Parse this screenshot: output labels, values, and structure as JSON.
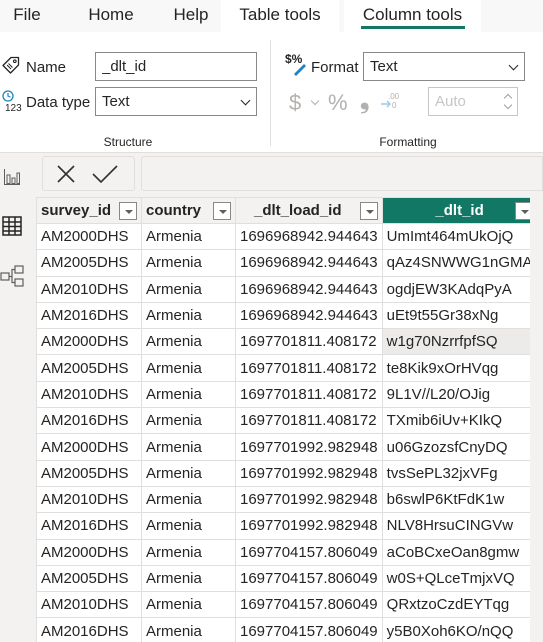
{
  "menu": {
    "tabs": [
      {
        "label": "File",
        "active": false
      },
      {
        "label": "Home",
        "active": false
      },
      {
        "label": "Help",
        "active": false
      },
      {
        "label": "Table tools",
        "active": false
      },
      {
        "label": "Column tools",
        "active": true
      }
    ],
    "accent_color": "#117865"
  },
  "ribbon": {
    "structure": {
      "group_label": "Structure",
      "name_label": "Name",
      "name_value": "_dlt_id",
      "data_type_label": "Data type",
      "data_type_value": "Text",
      "name_icon": "tag-icon",
      "data_type_icon": "data-type-123-icon"
    },
    "formatting": {
      "group_label": "Formatting",
      "format_label": "Format",
      "format_value": "Text",
      "format_icon": "dollar-percent-brush-icon",
      "currency_symbol": "$",
      "percent_symbol": "%",
      "comma_symbol": "❟",
      "decimal_places_placeholder": "Auto",
      "decimal_icon_text": ".00"
    }
  },
  "rail": {
    "items": [
      {
        "name": "report-view",
        "icon": "bar-chart-icon"
      },
      {
        "name": "data-view",
        "icon": "table-icon",
        "active": true
      },
      {
        "name": "model-view",
        "icon": "model-icon"
      }
    ]
  },
  "formula_bar": {
    "cancel_icon": "close-icon",
    "commit_icon": "check-icon",
    "value": ""
  },
  "table": {
    "columns": [
      {
        "key": "survey_id",
        "label": "survey_id",
        "selected": false
      },
      {
        "key": "country",
        "label": "country",
        "selected": false
      },
      {
        "key": "_dlt_load_id",
        "label": "_dlt_load_id",
        "selected": false
      },
      {
        "key": "_dlt_id",
        "label": "_dlt_id",
        "selected": true
      }
    ],
    "rows": [
      [
        "AM2000DHS",
        "Armenia",
        "1696968942.944643",
        "UmImt464mUkOjQ"
      ],
      [
        "AM2005DHS",
        "Armenia",
        "1696968942.944643",
        "qAz4SNWWG1nGMA"
      ],
      [
        "AM2010DHS",
        "Armenia",
        "1696968942.944643",
        "ogdjEW3KAdqPyA"
      ],
      [
        "AM2016DHS",
        "Armenia",
        "1696968942.944643",
        "uEt9t55Gr38xNg"
      ],
      [
        "AM2000DHS",
        "Armenia",
        "1697701811.408172",
        "w1g70NzrrfpfSQ"
      ],
      [
        "AM2005DHS",
        "Armenia",
        "1697701811.408172",
        "te8Kik9xOrHVqg"
      ],
      [
        "AM2010DHS",
        "Armenia",
        "1697701811.408172",
        "9L1V//L20/OJig"
      ],
      [
        "AM2016DHS",
        "Armenia",
        "1697701811.408172",
        "TXmib6iUv+KIkQ"
      ],
      [
        "AM2000DHS",
        "Armenia",
        "1697701992.982948",
        "u06GzozsfCnyDQ"
      ],
      [
        "AM2005DHS",
        "Armenia",
        "1697701992.982948",
        "tvsSePL32jxVFg"
      ],
      [
        "AM2010DHS",
        "Armenia",
        "1697701992.982948",
        "b6swlP6KtFdK1w"
      ],
      [
        "AM2016DHS",
        "Armenia",
        "1697701992.982948",
        "NLV8HrsuCINGVw"
      ],
      [
        "AM2000DHS",
        "Armenia",
        "1697704157.806049",
        "aCoBCxeOan8gmw"
      ],
      [
        "AM2005DHS",
        "Armenia",
        "1697704157.806049",
        "w0S+QLceTmjxVQ"
      ],
      [
        "AM2010DHS",
        "Armenia",
        "1697704157.806049",
        "QRxtzoCzdEYTqg"
      ],
      [
        "AM2016DHS",
        "Armenia",
        "1697704157.806049",
        "y5B0Xoh6KO/nQQ"
      ]
    ],
    "highlighted_row_index": 4
  }
}
